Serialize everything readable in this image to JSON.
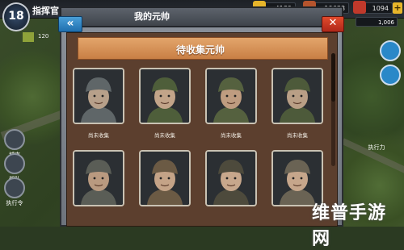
{
  "hud": {
    "level": "18",
    "commander_label": "指挥官",
    "rank_value": "120",
    "resources": [
      {
        "icon": "gold-coins-icon",
        "value": "4189",
        "color": "#e7b52a"
      },
      {
        "icon": "oil-barrel-icon",
        "value": "19638",
        "color": "#b5542d"
      },
      {
        "icon": "supply-crate-icon",
        "value": "1094",
        "color": "#c0392b"
      }
    ],
    "gems": "1,006",
    "left_menu": [
      "城市",
      "部队",
      "执行令"
    ],
    "right_menu": [
      "执行力"
    ]
  },
  "dialog": {
    "title": "我的元帅",
    "back_label": "«",
    "close_label": "✕",
    "banner": "待收集元帅",
    "cards": [
      {
        "caption": "尚未收集",
        "portrait": "soldier-helmet-smile"
      },
      {
        "caption": "尚未收集",
        "portrait": "soldier-helmet-grin"
      },
      {
        "caption": "尚未收集",
        "portrait": "soldier-helmet-shout"
      },
      {
        "caption": "尚未收集",
        "portrait": "soldier-helmet-calm"
      },
      {
        "caption": "尚未收集",
        "portrait": "soldier-goggles"
      },
      {
        "caption": "尚未收集",
        "portrait": "pilot-cap"
      },
      {
        "caption": "尚未收集",
        "portrait": "officer-cap"
      },
      {
        "caption": "尚未收集",
        "portrait": "officer-side-cap"
      }
    ]
  },
  "watermark": "维普手游网",
  "colors": {
    "panel": "#5c3f2e",
    "banner": "#d78f52",
    "back_button": "#2f86c8",
    "close_button": "#c9351f"
  }
}
